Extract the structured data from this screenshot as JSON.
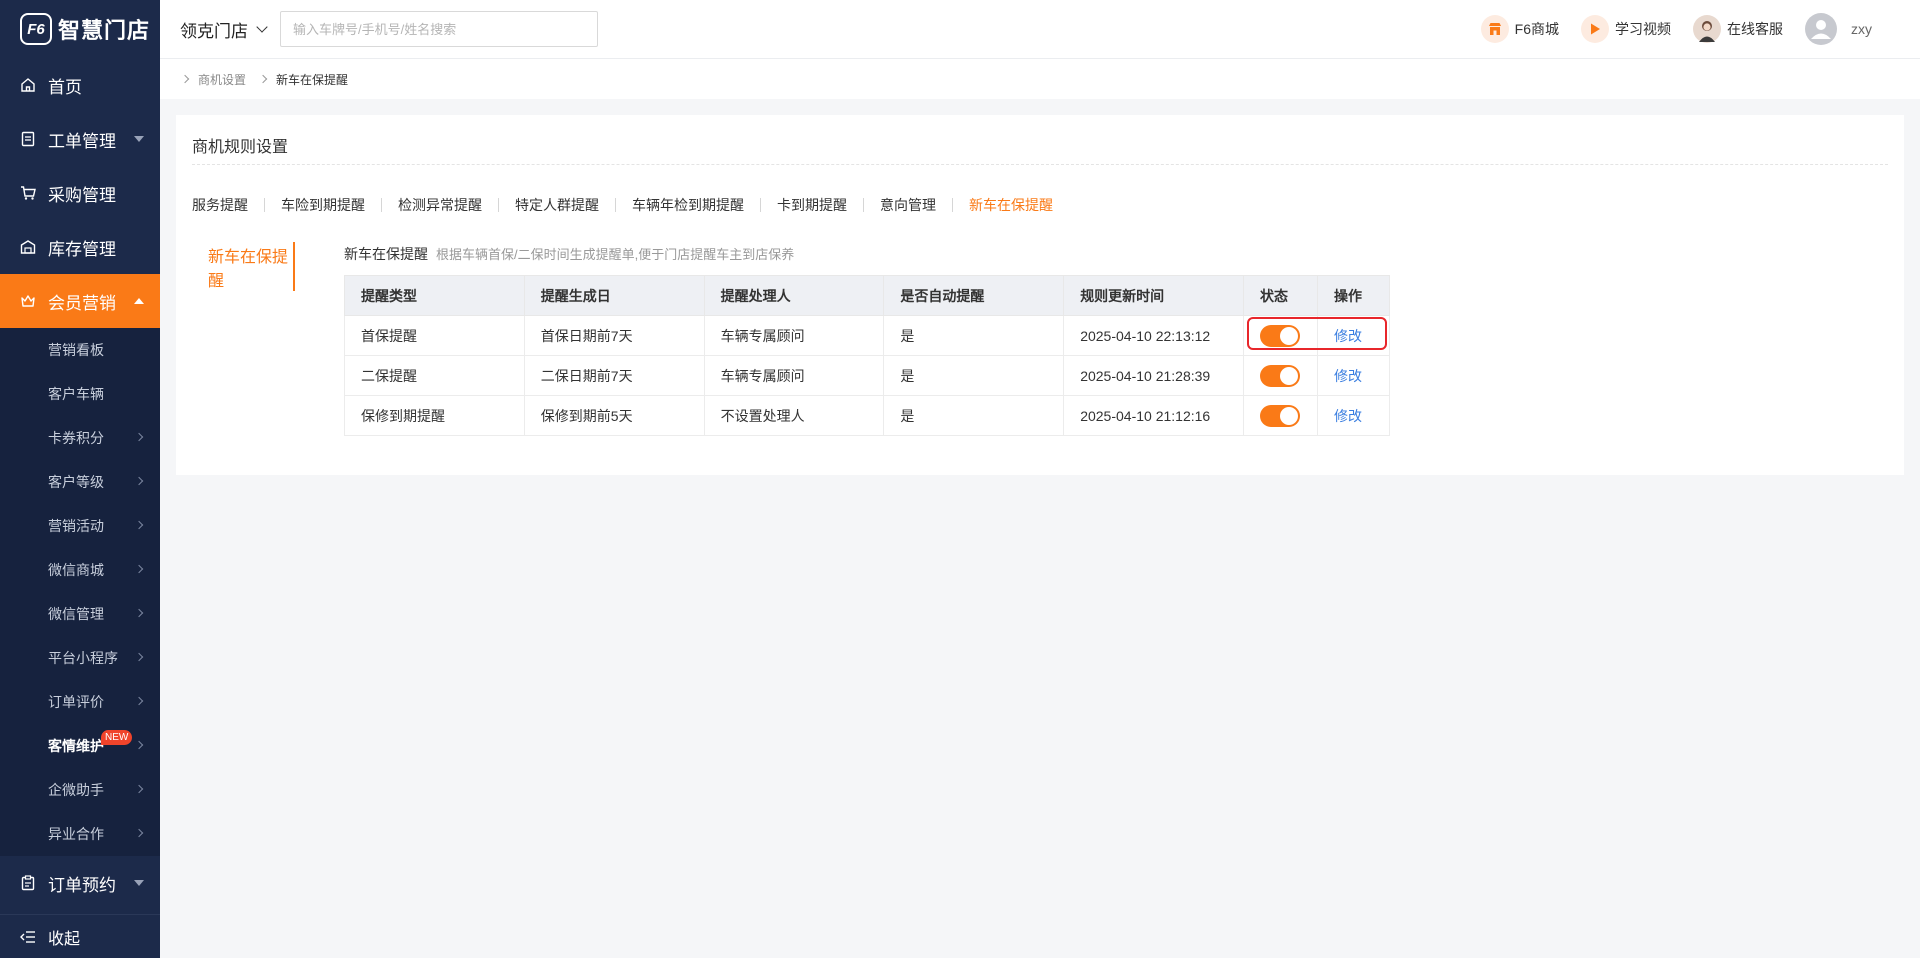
{
  "sidebar": {
    "logo_mark": "F6",
    "logo_text": "智慧门店",
    "items": [
      {
        "label": "首页"
      },
      {
        "label": "工单管理"
      },
      {
        "label": "采购管理"
      },
      {
        "label": "库存管理"
      },
      {
        "label": "会员营销"
      },
      {
        "label": "订单预约"
      }
    ],
    "sub_items": [
      {
        "label": "营销看板"
      },
      {
        "label": "客户车辆"
      },
      {
        "label": "卡券积分"
      },
      {
        "label": "客户等级"
      },
      {
        "label": "营销活动"
      },
      {
        "label": "微信商城"
      },
      {
        "label": "微信管理"
      },
      {
        "label": "平台小程序"
      },
      {
        "label": "订单评价"
      },
      {
        "label": "客情维护",
        "badge": "NEW"
      },
      {
        "label": "企微助手"
      },
      {
        "label": "异业合作"
      }
    ],
    "collapse_label": "收起"
  },
  "topbar": {
    "store_name": "领克门店",
    "search_placeholder": "输入车牌号/手机号/姓名搜索",
    "f6_mall": "F6商城",
    "learning_video": "学习视频",
    "online_service": "在线客服",
    "username": "zxy"
  },
  "breadcrumb": {
    "parent": "商机设置",
    "current": "新车在保提醒"
  },
  "card": {
    "title": "商机规则设置",
    "tabs": [
      "服务提醒",
      "车险到期提醒",
      "检测异常提醒",
      "特定人群提醒",
      "车辆年检到期提醒",
      "卡到期提醒",
      "意向管理",
      "新车在保提醒"
    ],
    "active_tab": "新车在保提醒",
    "side_label": "新车在保提醒",
    "section_title": "新车在保提醒",
    "section_desc": "根据车辆首保/二保时间生成提醒单,便于门店提醒车主到店保养"
  },
  "table": {
    "headers": [
      "提醒类型",
      "提醒生成日",
      "提醒处理人",
      "是否自动提醒",
      "规则更新时间",
      "状态",
      "操作"
    ],
    "rows": [
      {
        "type": "首保提醒",
        "gen_day": "首保日期前7天",
        "handler": "车辆专属顾问",
        "auto": "是",
        "updated": "2025-04-10 22:13:12",
        "status_on": true,
        "action": "修改"
      },
      {
        "type": "二保提醒",
        "gen_day": "二保日期前7天",
        "handler": "车辆专属顾问",
        "auto": "是",
        "updated": "2025-04-10 21:28:39",
        "status_on": true,
        "action": "修改"
      },
      {
        "type": "保修到期提醒",
        "gen_day": "保修到期前5天",
        "handler": "不设置处理人",
        "auto": "是",
        "updated": "2025-04-10 21:12:16",
        "status_on": true,
        "action": "修改"
      }
    ]
  },
  "colors": {
    "accent": "#fa7a17",
    "sidebar_bg": "#1c2a4a",
    "link": "#3a7ee0",
    "highlight": "#e8262b"
  }
}
